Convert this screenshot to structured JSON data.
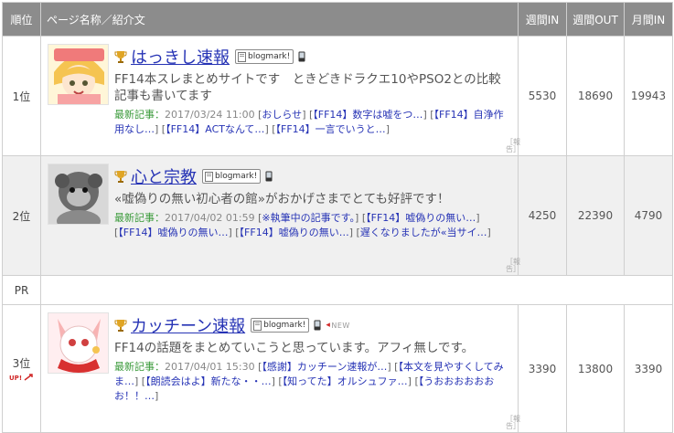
{
  "headers": {
    "rank": "順位",
    "name": "ページ名称／紹介文",
    "week_in": "週間IN",
    "week_out": "週間OUT",
    "month_in": "月間IN"
  },
  "pr_label": "PR",
  "badge_label": "blogmark!",
  "latest_label": "最新記事：",
  "report_label": "［報告］",
  "up_label": "UP!",
  "new_label": "NEW",
  "rows": [
    {
      "rank": "1位",
      "title": "はっきし速報",
      "desc": "FF14本スレまとめサイトです　ときどきドラクエ10やPSO2との比較記事も書いてます",
      "date": "2017/03/24 11:00",
      "articles": [
        "おしらせ",
        "【FF14】数字は嘘をつ…",
        "【FF14】自浄作用なし…",
        "【FF14】ACTなんて…",
        "【FF14】一言でいうと…"
      ],
      "week_in": "5530",
      "week_out": "18690",
      "month_in": "19943"
    },
    {
      "rank": "2位",
      "title": "心と宗教",
      "desc": "«嘘偽りの無い初心者の館»がおかげさまでとても好評です！",
      "date": "2017/04/02 01:59",
      "articles": [
        "※執筆中の記事です。",
        "【FF14】嘘偽りの無い…",
        "【FF14】嘘偽りの無い…",
        "【FF14】嘘偽りの無い…",
        "遅くなりましたが«当サイ…"
      ],
      "week_in": "4250",
      "week_out": "22390",
      "month_in": "4790"
    },
    {
      "rank": "3位",
      "title": "カッチーン速報",
      "desc": "FF14の話題をまとめていこうと思っています。アフィ無しです。",
      "date": "2017/04/01 15:30",
      "articles": [
        "【感謝】カッチーン速報が…",
        "【本文を見やすくしてみま…",
        "【朗読会はよ】新たな・・…",
        "【知ってた】オルシュファ…",
        "【うおおおおおおお！！…"
      ],
      "week_in": "3390",
      "week_out": "13800",
      "month_in": "3390"
    }
  ],
  "colors": {
    "header_bg": "#8c8c8c",
    "link_blue": "#2633b5",
    "label_green": "#3a9a3a",
    "row_alt": "#f0f0f0"
  }
}
